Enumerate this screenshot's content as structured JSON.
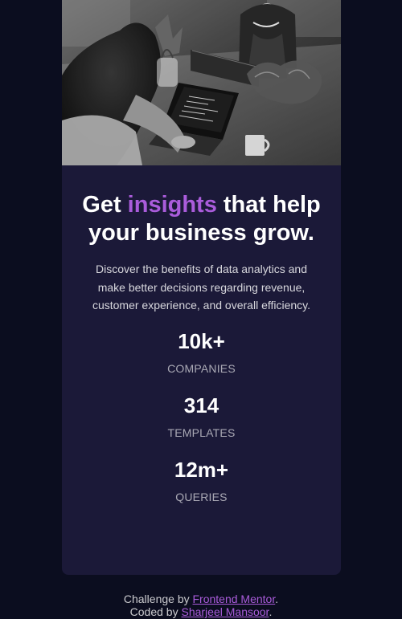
{
  "card": {
    "image_alt": "Team working together on laptops",
    "heading": {
      "before": "Get ",
      "accent": "insights",
      "after": " that help your business grow."
    },
    "description": "Discover the benefits of data analytics and make better decisions regarding revenue, customer experience, and overall efficiency.",
    "stats": [
      {
        "value": "10k+",
        "label": "Companies"
      },
      {
        "value": "314",
        "label": "Templates"
      },
      {
        "value": "12m+",
        "label": "Queries"
      }
    ]
  },
  "attribution": {
    "line1_prefix": "Challenge by ",
    "line1_link": "Frontend Mentor",
    "line1_suffix": ".",
    "line2_prefix": "Coded by ",
    "line2_link": "Sharjeel Mansoor",
    "line2_suffix": "."
  },
  "colors": {
    "page_background": "#0b0d1f",
    "card_background": "#1b1938",
    "accent": "#aa5cdb",
    "text_primary": "#ffffff"
  }
}
